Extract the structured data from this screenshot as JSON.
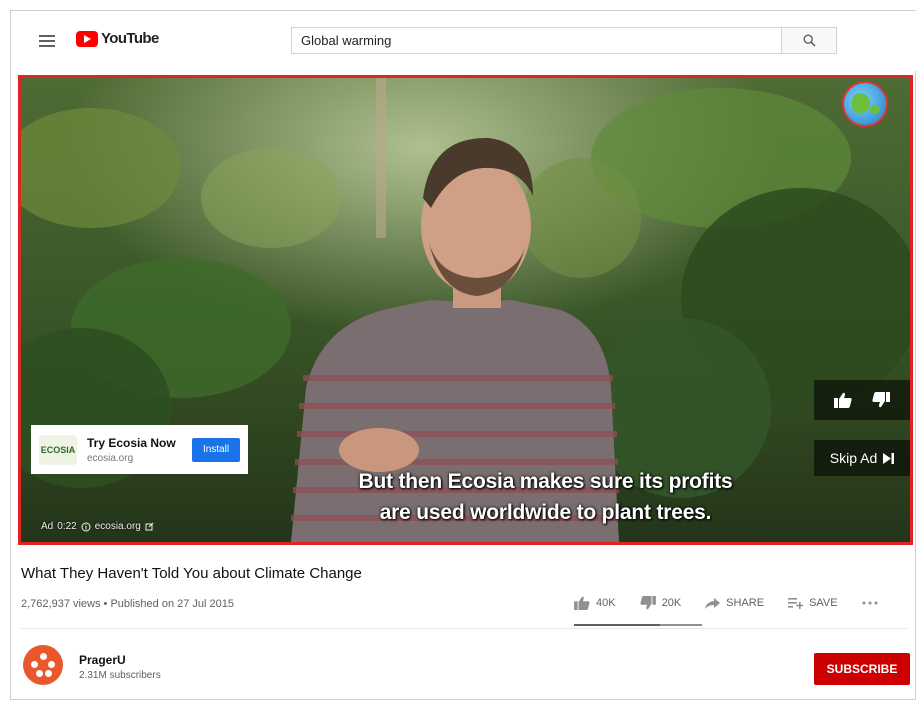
{
  "header": {
    "logo_text": "YouTube",
    "search_value": "Global warming"
  },
  "player": {
    "captions": [
      "But then Ecosia makes sure its profits",
      "are used worldwide to plant trees."
    ],
    "ad_card": {
      "logo_text": "ECOSIA",
      "title": "Try Ecosia Now",
      "url": "ecosia.org",
      "install_label": "Install"
    },
    "ad_meta": {
      "label": "Ad",
      "time": "0:22",
      "domain": "ecosia.org"
    },
    "skip_label": "Skip Ad"
  },
  "video": {
    "title": "What They Haven't Told You about Climate Change",
    "meta": "2,762,937 views • Published on 27 Jul 2015",
    "likes": "40K",
    "dislikes": "20K",
    "share_label": "SHARE",
    "save_label": "SAVE",
    "like_ratio": 0.67
  },
  "channel": {
    "name": "PragerU",
    "subscribers": "2.31M subscribers",
    "subscribe_label": "SUBSCRIBE"
  },
  "colors": {
    "brand_red": "#ff0000",
    "subscribe_red": "#cc0000",
    "ad_highlight_border": "#e02424",
    "install_blue": "#1a73e8",
    "avatar_orange": "#e9572c"
  }
}
